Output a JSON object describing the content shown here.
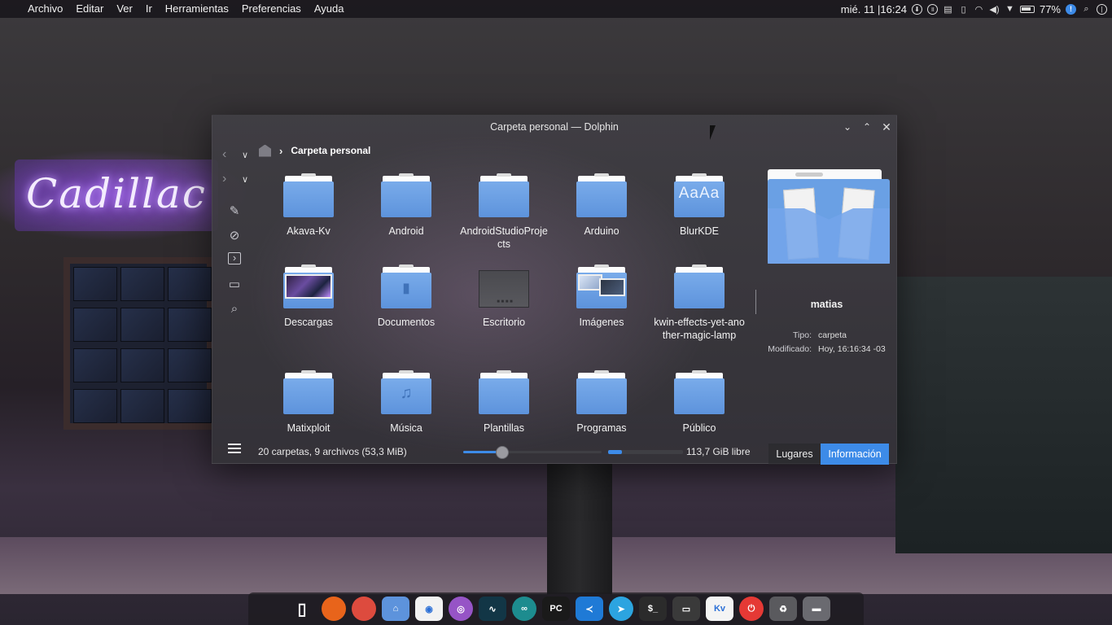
{
  "menubar": {
    "apple_glyph": "",
    "items": [
      "Archivo",
      "Editar",
      "Ver",
      "Ir",
      "Herramientas",
      "Preferencias",
      "Ayuda"
    ],
    "clock": "mié. 11 |16:24",
    "battery": "77%",
    "tray_icons": [
      "download-icon",
      "pause-icon",
      "clipboard-icon",
      "battery-small-icon",
      "wifi-icon",
      "volume-icon",
      "triangle-down-icon",
      "battery-icon",
      "info-icon",
      "search-icon",
      "power-icon"
    ]
  },
  "desktop": {
    "neon_sign": "Cadillac"
  },
  "window": {
    "title": "Carpeta personal — Dolphin",
    "breadcrumb": {
      "current": "Carpeta personal"
    },
    "toolbar_icons": [
      "pencil-icon",
      "hidden-files-icon",
      "terminal-icon",
      "new-folder-icon",
      "search-icon"
    ],
    "items": [
      {
        "label": "Akava-Kv",
        "kind": "folder"
      },
      {
        "label": "Android",
        "kind": "folder"
      },
      {
        "label": "AndroidStudioProjects",
        "kind": "folder"
      },
      {
        "label": "Arduino",
        "kind": "folder"
      },
      {
        "label": "BlurKDE",
        "kind": "folder-aa",
        "glyph": "AaAa"
      },
      {
        "label": "Descargas",
        "kind": "folder-photo"
      },
      {
        "label": "Documentos",
        "kind": "folder-doc"
      },
      {
        "label": "Escritorio",
        "kind": "desktop"
      },
      {
        "label": "Imágenes",
        "kind": "folder-images"
      },
      {
        "label": "kwin-effects-yet-another-magic-lamp",
        "kind": "folder"
      },
      {
        "label": "Matixploit",
        "kind": "folder"
      },
      {
        "label": "Música",
        "kind": "folder-music",
        "glyph": "♫"
      },
      {
        "label": "Plantillas",
        "kind": "folder"
      },
      {
        "label": "Programas",
        "kind": "folder"
      },
      {
        "label": "Público",
        "kind": "folder"
      }
    ],
    "info": {
      "name": "matias",
      "type_label": "Tipo:",
      "type_value": "carpeta",
      "modified_label": "Modificado:",
      "modified_value": "Hoy, 16:16:34 -03"
    },
    "status": {
      "summary": "20 carpetas, 9 archivos (53,3 MiB)",
      "zoom_fraction": 0.28,
      "free_space": "113,7 GiB libre",
      "used_fraction": 0.18
    },
    "panel_tabs": [
      {
        "label": "Lugares",
        "active": false
      },
      {
        "label": "Información",
        "active": true
      }
    ]
  },
  "dock": {
    "apps": [
      {
        "name": "finder-icon",
        "glyph": "",
        "bg": "transparent"
      },
      {
        "name": "window-switcher-icon",
        "glyph": "▯",
        "bg": "transparent"
      },
      {
        "name": "firefox-icon",
        "glyph": "",
        "bg": "#e8641b"
      },
      {
        "name": "chrome-icon",
        "glyph": "",
        "bg": "#dd4b3e"
      },
      {
        "name": "dolphin-icon",
        "glyph": "⌂",
        "bg": "#5d93dc"
      },
      {
        "name": "settings-toggle-icon",
        "glyph": "◉",
        "bg": "#f2f2f2"
      },
      {
        "name": "obs-icon",
        "glyph": "◎",
        "bg": "#9654c6"
      },
      {
        "name": "system-monitor-icon",
        "glyph": "∿",
        "bg": "#123646"
      },
      {
        "name": "arduino-icon",
        "glyph": "∞",
        "bg": "#1d8c8f"
      },
      {
        "name": "pycharm-icon",
        "glyph": "PC",
        "bg": "#1a1a1a"
      },
      {
        "name": "vscode-icon",
        "glyph": "≺",
        "bg": "#1f7ad6"
      },
      {
        "name": "telegram-icon",
        "glyph": "➤",
        "bg": "#2ca4e0"
      },
      {
        "name": "terminal-icon",
        "glyph": "$_",
        "bg": "#2b2b2b"
      },
      {
        "name": "screenshot-icon",
        "glyph": "▭",
        "bg": "#3a3a3a"
      },
      {
        "name": "kvantum-icon",
        "glyph": "Kv",
        "bg": "#f4f4f4"
      },
      {
        "name": "power-icon",
        "glyph": "⏻",
        "bg": "#e53935"
      },
      {
        "name": "trash-icon",
        "glyph": "♻",
        "bg": "#5a5a5e"
      },
      {
        "name": "desktop-icon",
        "glyph": "▬",
        "bg": "#6a6a70"
      }
    ]
  }
}
